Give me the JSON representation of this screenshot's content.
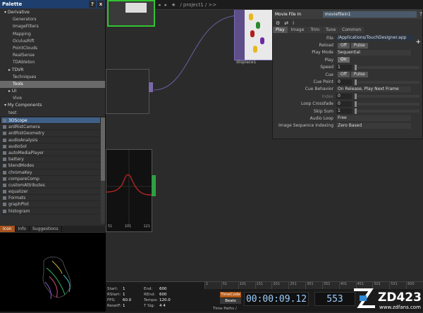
{
  "palette": {
    "title": "Palette",
    "help_label": "?",
    "close_label": "x",
    "tree": [
      {
        "label": "Derivative",
        "folder": true,
        "indent": 1,
        "arrow": "▾"
      },
      {
        "label": "Generators",
        "indent": 3
      },
      {
        "label": "ImageFilters",
        "indent": 3
      },
      {
        "label": "Mapping",
        "indent": 3
      },
      {
        "label": "OculusRift",
        "indent": 3
      },
      {
        "label": "PointClouds",
        "indent": 3
      },
      {
        "label": "RealSense",
        "indent": 3
      },
      {
        "label": "TDAbleton",
        "indent": 3
      },
      {
        "label": "TDVR",
        "folder": true,
        "indent": 2,
        "arrow": "▸"
      },
      {
        "label": "Techniques",
        "indent": 3
      },
      {
        "label": "Tools",
        "indent": 3,
        "selected": true
      },
      {
        "label": "UI",
        "folder": true,
        "indent": 2,
        "arrow": "▸"
      },
      {
        "label": "Vive",
        "indent": 3
      },
      {
        "label": "My Components",
        "folder": true,
        "indent": 1,
        "arrow": "▾"
      },
      {
        "label": "test",
        "indent": 2
      }
    ],
    "components": [
      "3DScope",
      "ardRistCamera",
      "ardRistGeometry",
      "audioAnalysis",
      "audioSol",
      "autoMediaPlayer",
      "battery",
      "blendModes",
      "chromaKey",
      "compareComp",
      "customAttributes",
      "equalizer",
      "Formats",
      "graphPlot",
      "histogram"
    ],
    "bottom_tabs": [
      "Icon",
      "Info",
      "Suggestions"
    ]
  },
  "network": {
    "path": "/ project1 / >>",
    "node_label": "displace1"
  },
  "params": {
    "op_type": "Movie File In",
    "op_name": "moviefilein1",
    "tabs": [
      "Play",
      "Image",
      "Trim",
      "Tune",
      "Common"
    ],
    "rows": [
      {
        "label": "File",
        "value": "/Applications/TouchDesigner.app",
        "kind": "field"
      },
      {
        "label": "Reload",
        "value": "Off",
        "extra": "Pulse",
        "kind": "toggle"
      },
      {
        "label": "Play Mode",
        "value": "Sequential",
        "kind": "menu"
      },
      {
        "label": "Play",
        "value": "On",
        "kind": "toggle-on"
      },
      {
        "label": "Speed",
        "value": "1",
        "kind": "slider"
      },
      {
        "label": "Cue",
        "value": "Off",
        "extra": "Pulse",
        "kind": "toggle"
      },
      {
        "label": "Cue Point",
        "value": "0",
        "kind": "slider"
      },
      {
        "label": "Cue Behavior",
        "value": "On Release, Play Next Frame",
        "kind": "menu"
      },
      {
        "label": "Index",
        "value": "0",
        "kind": "slider",
        "dim": true
      },
      {
        "label": "Loop Crossfade",
        "value": "0",
        "kind": "slider"
      },
      {
        "label": "Skip Sum",
        "value": "1",
        "kind": "slider"
      },
      {
        "label": "Audio Loop",
        "value": "Free",
        "kind": "menu"
      },
      {
        "label": "Image Sequence Indexing",
        "value": "Zero Based",
        "kind": "menu"
      }
    ]
  },
  "timeline": {
    "ruler": [
      "1",
      "51",
      "101",
      "151",
      "201",
      "251",
      "301",
      "351",
      "401",
      "451",
      "501",
      "551",
      "600"
    ],
    "stats": [
      {
        "k": "Start:",
        "v": "1",
        "k2": "End:",
        "v2": "600"
      },
      {
        "k": "RStart:",
        "v": "1",
        "k2": "REnd:",
        "v2": "600"
      },
      {
        "k": "FPS:",
        "v": "60.0",
        "k2": "Tempo:",
        "v2": "120.0"
      },
      {
        "k": "ResetF:",
        "v": "1",
        "k2": "T Sig:",
        "v2": "4  4"
      }
    ],
    "timecode_label": "TimeCode",
    "beats_label": "Beats",
    "time_paths_label": "Time Paths /",
    "timecode": "00:00:09.12",
    "frame": "553"
  },
  "chart_ticks": [
    "51",
    "101",
    "121"
  ],
  "logo": {
    "brand": "ZD423",
    "url": "www.zdfans.com"
  }
}
